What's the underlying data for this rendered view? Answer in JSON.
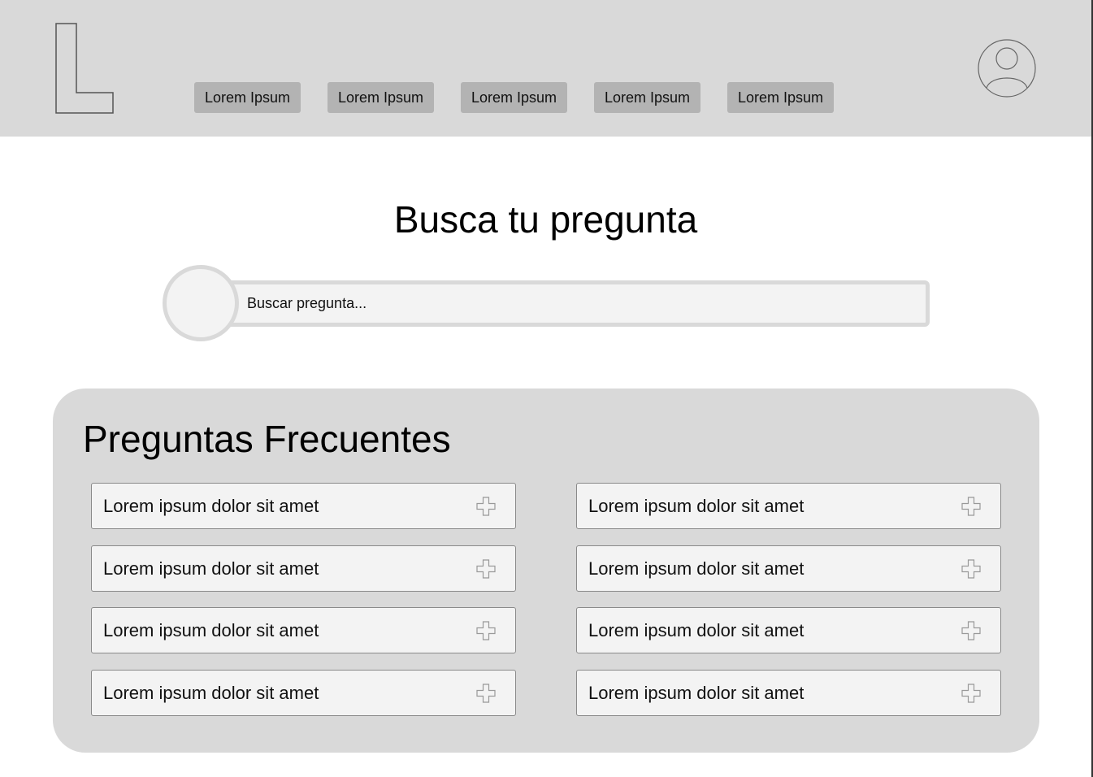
{
  "nav": {
    "items": [
      {
        "label": "Lorem Ipsum"
      },
      {
        "label": "Lorem Ipsum"
      },
      {
        "label": "Lorem Ipsum"
      },
      {
        "label": "Lorem Ipsum"
      },
      {
        "label": "Lorem Ipsum"
      }
    ]
  },
  "logo": {
    "icon": "letter-l-logo"
  },
  "avatar": {
    "icon": "user-avatar-icon"
  },
  "search": {
    "title": "Busca tu pregunta",
    "placeholder": "Buscar pregunta...",
    "value": ""
  },
  "faq": {
    "title": "Preguntas Frecuentes",
    "items": [
      {
        "label": "Lorem ipsum dolor sit amet",
        "icon": "plus-icon"
      },
      {
        "label": "Lorem ipsum dolor sit amet",
        "icon": "plus-icon"
      },
      {
        "label": "Lorem ipsum dolor sit amet",
        "icon": "plus-icon"
      },
      {
        "label": "Lorem ipsum dolor sit amet",
        "icon": "plus-icon"
      },
      {
        "label": "Lorem ipsum dolor sit amet",
        "icon": "plus-icon"
      },
      {
        "label": "Lorem ipsum dolor sit amet",
        "icon": "plus-icon"
      },
      {
        "label": "Lorem ipsum dolor sit amet",
        "icon": "plus-icon"
      },
      {
        "label": "Lorem ipsum dolor sit amet",
        "icon": "plus-icon"
      }
    ]
  },
  "colors": {
    "header_bg": "#d9d9d9",
    "nav_button_bg": "#b3b3b3",
    "panel_bg": "#d9d9d9",
    "item_bg": "#f3f3f3"
  }
}
